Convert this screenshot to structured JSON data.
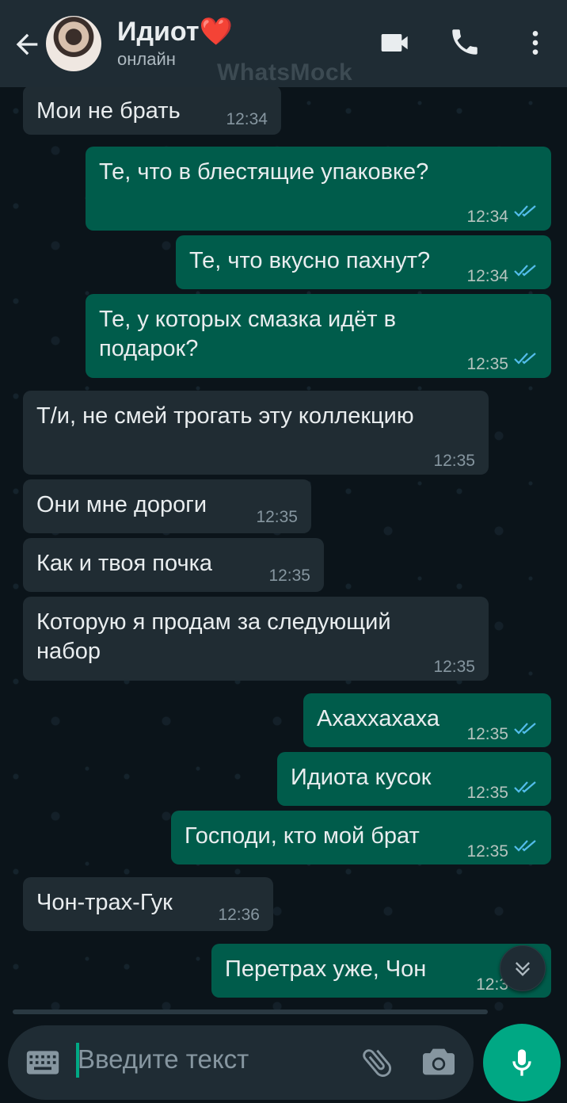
{
  "header": {
    "contact_name": "Идиот",
    "name_emoji": "❤️",
    "status": "онлайн",
    "watermark": "WhatsMock"
  },
  "messages": [
    {
      "dir": "in",
      "text": "Мои не брать",
      "time": "12:34"
    },
    {
      "dir": "out",
      "text": "Те, что в блестящие упаковке?",
      "time": "12:34",
      "read": true
    },
    {
      "dir": "out",
      "text": "Те, что вкусно пахнут?",
      "time": "12:34",
      "read": true
    },
    {
      "dir": "out",
      "text": "Те, у которых смазка идёт в подарок?",
      "time": "12:35",
      "read": true
    },
    {
      "dir": "in",
      "text": "Т/и, не смей трогать эту коллекцию",
      "time": "12:35"
    },
    {
      "dir": "in",
      "text": "Они мне дороги",
      "time": "12:35"
    },
    {
      "dir": "in",
      "text": "Как и твоя почка",
      "time": "12:35"
    },
    {
      "dir": "in",
      "text": "Которую я продам за следующий набор",
      "time": "12:35"
    },
    {
      "dir": "out",
      "text": "Ахаххахаха",
      "time": "12:35",
      "read": true
    },
    {
      "dir": "out",
      "text": "Идиота кусок",
      "time": "12:35",
      "read": true
    },
    {
      "dir": "out",
      "text": "Господи, кто мой брат",
      "time": "12:35",
      "read": true
    },
    {
      "dir": "in",
      "text": "Чон-трах-Гук",
      "time": "12:36"
    },
    {
      "dir": "out",
      "text": "Перетрах уже, Чон",
      "time": "12:3",
      "read": true
    }
  ],
  "input": {
    "placeholder": "Введите текст"
  },
  "colors": {
    "incoming_bubble": "#202c33",
    "outgoing_bubble": "#005c4b",
    "accent": "#00a884",
    "read_ticks": "#53bdeb"
  },
  "icons": [
    "back-arrow-icon",
    "video-call-icon",
    "phone-icon",
    "more-vert-icon",
    "keyboard-icon",
    "attach-icon",
    "camera-icon",
    "mic-icon",
    "chevron-double-down-icon",
    "double-check-icon"
  ]
}
